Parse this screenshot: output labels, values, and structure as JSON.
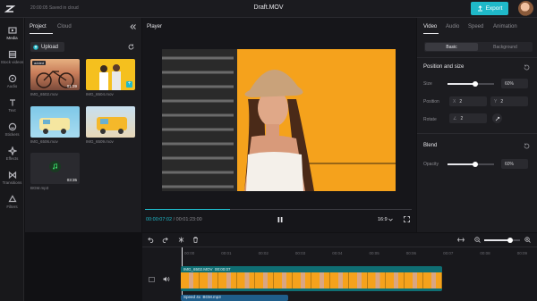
{
  "header": {
    "save_status": "20:00:05 Saved in cloud",
    "title": "Draft.MOV",
    "export_label": "Export",
    "accent_color": "#1fb9c9"
  },
  "nav": {
    "items": [
      {
        "label": "Media",
        "icon": "media-icon"
      },
      {
        "label": "Stock videos",
        "icon": "stock-videos-icon"
      },
      {
        "label": "Audio",
        "icon": "audio-icon"
      },
      {
        "label": "Text",
        "icon": "text-icon"
      },
      {
        "label": "Stickers",
        "icon": "stickers-icon"
      },
      {
        "label": "Effects",
        "icon": "effects-icon"
      },
      {
        "label": "Transitions",
        "icon": "transitions-icon"
      },
      {
        "label": "Filters",
        "icon": "filters-icon"
      }
    ]
  },
  "media": {
    "tabs": [
      "Project",
      "Cloud"
    ],
    "upload_label": "Upload",
    "items": [
      {
        "name": "IMG_6502.mov",
        "duration": "01:39"
      },
      {
        "name": "IMG_6504.mov",
        "duration": ""
      },
      {
        "name": "IMG_6506.mov",
        "duration": ""
      },
      {
        "name": "IMG_6509.mov",
        "duration": ""
      },
      {
        "name": "BGM.mp3",
        "duration": "03:35"
      }
    ]
  },
  "player": {
    "label": "Player",
    "current_time": "00:00:07:02",
    "total_time": "00:01:23:00",
    "aspect_ratio": "16:9"
  },
  "properties": {
    "tabs": [
      "Video",
      "Audio",
      "Speed",
      "Animation"
    ],
    "modes": [
      "Basic",
      "Background"
    ],
    "position_section": "Position and size",
    "size_label": "Size",
    "size_value": "60%",
    "size_fraction": 0.6,
    "position_label": "Position",
    "x_label": "X",
    "x_value": "2",
    "y_label": "Y",
    "y_value": "2",
    "rotate_label": "Rotate",
    "rotate_value": "2",
    "blend_section": "Blend",
    "opacity_label": "Opacity",
    "opacity_value": "60%",
    "opacity_fraction": 0.6
  },
  "timeline": {
    "ticks": [
      "00:00",
      "00:01",
      "00:02",
      "00:03",
      "00:04",
      "00:05",
      "00:06",
      "00:07",
      "00:08",
      "00:09"
    ],
    "video_clip_name": "IMG_6502.MOV",
    "video_clip_time": "00:00:07",
    "audio_speed": "Speed 4x",
    "audio_clip_name": "BGM.mp3",
    "zoom_fraction": 0.72
  }
}
